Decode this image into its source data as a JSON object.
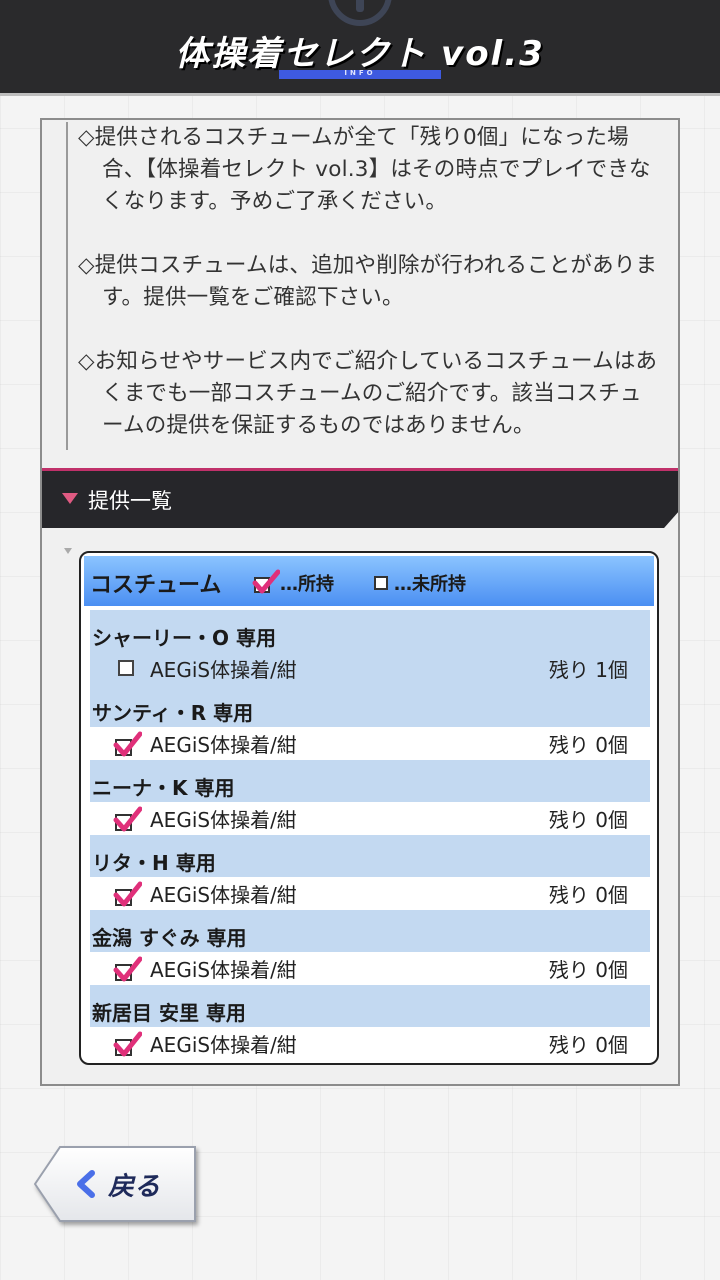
{
  "header": {
    "title": "体操着セレクト vol.3",
    "subtitle": "INFO"
  },
  "notes": [
    "◇提供されるコスチュームが全て「残り0個」になった場合、【体操着セレクト vol.3】はその時点でプレイできなくなります。予めご了承ください。",
    "◇提供コスチュームは、追加や削除が行われることがあります。提供一覧をご確認下さい。",
    "◇お知らせやサービス内でご紹介しているコスチュームはあくまでも一部コスチュームのご紹介です。該当コスチュームの提供を保証するものではありません。"
  ],
  "section": {
    "title": "提供一覧"
  },
  "list": {
    "header_title": "コスチューム",
    "legend_owned": "…所持",
    "legend_unowned": "…未所持",
    "accent_color": "#e0307a",
    "entries": [
      {
        "character": "シャーリー・O 専用",
        "item": "AEGiS体操着/紺",
        "remaining": "残り 1個",
        "owned": false
      },
      {
        "character": "サンティ・R 専用",
        "item": "AEGiS体操着/紺",
        "remaining": "残り 0個",
        "owned": true
      },
      {
        "character": "ニーナ・K 専用",
        "item": "AEGiS体操着/紺",
        "remaining": "残り 0個",
        "owned": true
      },
      {
        "character": "リタ・H 専用",
        "item": "AEGiS体操着/紺",
        "remaining": "残り 0個",
        "owned": true
      },
      {
        "character": "金潟 すぐみ 専用",
        "item": "AEGiS体操着/紺",
        "remaining": "残り 0個",
        "owned": true
      },
      {
        "character": "新居目 安里 専用",
        "item": "AEGiS体操着/紺",
        "remaining": "残り 0個",
        "owned": true
      }
    ]
  },
  "footer": {
    "back_label": "戻る",
    "back_icon": "chevron-left-icon"
  }
}
